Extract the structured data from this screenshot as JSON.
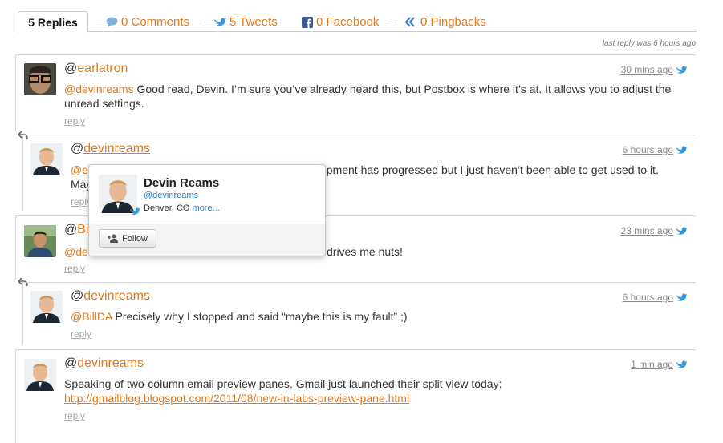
{
  "tabs": {
    "replies": "5 Replies",
    "comments": "0 Comments",
    "tweets": "5 Tweets",
    "facebook": "0 Facebook",
    "pingbacks": "0 Pingbacks"
  },
  "last_reply": "last reply was 6 hours ago",
  "reply_label": "reply",
  "comments": [
    {
      "user": "earlatron",
      "time": "30 mins ago",
      "mention": "@devinreams",
      "text": "Good read, Devin. I’m sure you’ve already heard this, but Postbox is where it’s at. It allows you to adjust the unread settings."
    },
    {
      "user": "devinreams",
      "time": "6 hours ago",
      "mention": "@ea",
      "text_visible_left": "May",
      "text_visible_right": "opment has progressed but I just haven’t been able to get used to it."
    },
    {
      "user": "Bil",
      "time": "23 mins ago",
      "mention": "@dev",
      "text_visible_right": "drives me nuts!"
    },
    {
      "user": "devinreams",
      "time": "6 hours ago",
      "mention": "@BillDA",
      "text": "Precisely why I stopped and said “maybe this is my fault” ;)"
    },
    {
      "user": "devinreams",
      "time": "1 min ago",
      "text": "Speaking of two-column email preview panes. Gmail just launched their split view today:",
      "link": "http://gmailblog.blogspot.com/2011/08/new-in-labs-preview-pane.html"
    }
  ],
  "popover": {
    "name": "Devin Reams",
    "handle": "@devinreams",
    "location": "Denver, CO",
    "more": "more...",
    "follow": "Follow"
  },
  "colors": {
    "accent": "#e07a1c",
    "twitter": "#2b82c4"
  }
}
